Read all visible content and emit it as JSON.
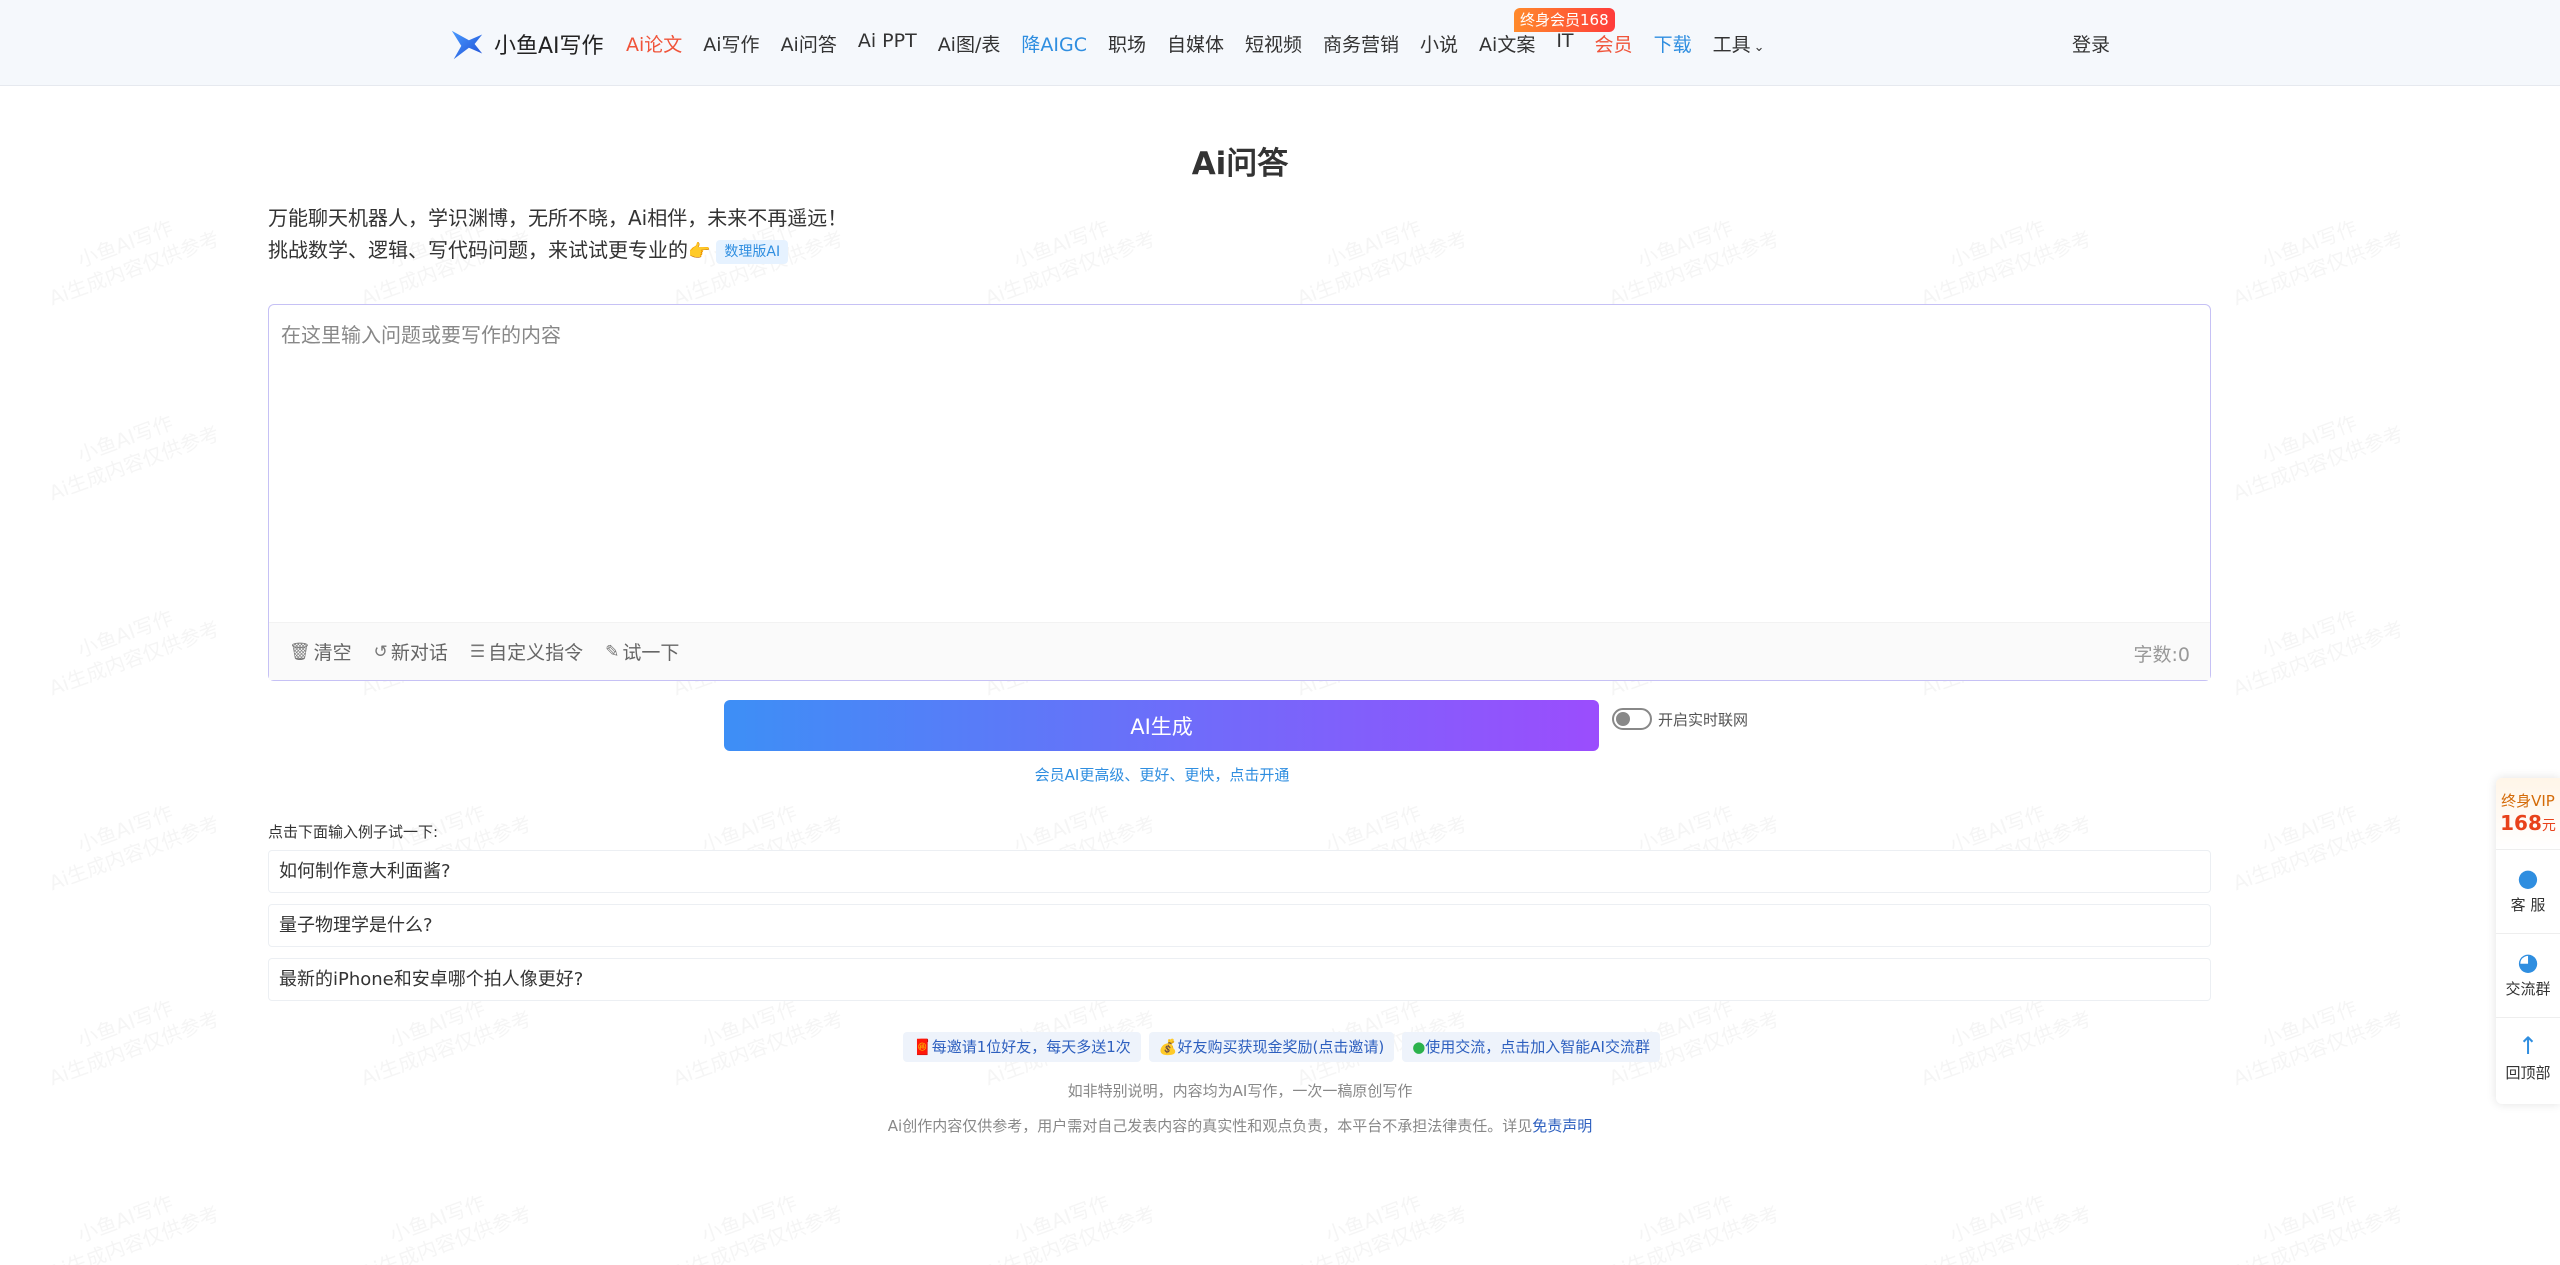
{
  "header": {
    "logo_text": "小鱼AI写作",
    "nav": [
      {
        "label": "Ai论文",
        "color": "red"
      },
      {
        "label": "Ai写作",
        "color": ""
      },
      {
        "label": "Ai问答",
        "color": ""
      },
      {
        "label": "Ai PPT",
        "color": ""
      },
      {
        "label": "Ai图/表",
        "color": ""
      },
      {
        "label": "降AIGC",
        "color": "blue"
      },
      {
        "label": "职场",
        "color": ""
      },
      {
        "label": "自媒体",
        "color": ""
      },
      {
        "label": "短视频",
        "color": ""
      },
      {
        "label": "商务营销",
        "color": ""
      },
      {
        "label": "小说",
        "color": ""
      },
      {
        "label": "Ai文案",
        "color": ""
      },
      {
        "label": "IT",
        "color": ""
      },
      {
        "label": "会员",
        "color": "red"
      },
      {
        "label": "下载",
        "color": "blue"
      },
      {
        "label": "工具",
        "color": ""
      }
    ],
    "vip_badge": "终身会员168",
    "login": "登录"
  },
  "main": {
    "title": "Ai问答",
    "intro_line1": "万能聊天机器人，学识渊博，无所不晓，Ai相伴，未来不再遥远！",
    "intro_line2": "挑战数学、逻辑、写代码问题，来试试更专业的",
    "pro_badge": "数理版AI",
    "editor_placeholder": "在这里输入问题或要写作的内容",
    "tools": {
      "clear": "清空",
      "new_chat": "新对话",
      "custom": "自定义指令",
      "try": "试一下"
    },
    "word_count": "字数:0",
    "generate_button": "AI生成",
    "realtime_toggle": "开启实时联网",
    "member_link": "会员AI更高级、更好、更快，点击开通",
    "examples_hint": "点击下面输入例子试一下:",
    "examples": [
      "如何制作意大利面酱?",
      "量子物理学是什么?",
      "最新的iPhone和安卓哪个拍人像更好?"
    ],
    "promos": [
      "每邀请1位好友，每天多送1次",
      "好友购买获现金奖励(点击邀请)",
      "使用交流，点击加入智能AI交流群"
    ],
    "footer_line1": "如非特别说明，内容均为AI写作，一次一稿原创写作",
    "footer_line2": "Ai创作内容仅供参考，用户需对自己发表内容的真实性和观点负责，本平台不承担法律责任。详见",
    "footer_link": "免责声明"
  },
  "side": {
    "vip_top": "终身VIP",
    "vip_price": "168",
    "vip_unit": "元",
    "service": "客 服",
    "group": "交流群",
    "top": "回顶部"
  },
  "watermark": "小鱼AI写作\nAi生成内容仅供参考",
  "colors": {
    "accent_red": "#f0543a",
    "accent_blue": "#2f8ee0",
    "button_gradient_start": "#3d8ff6",
    "button_gradient_end": "#9b4dfd"
  }
}
